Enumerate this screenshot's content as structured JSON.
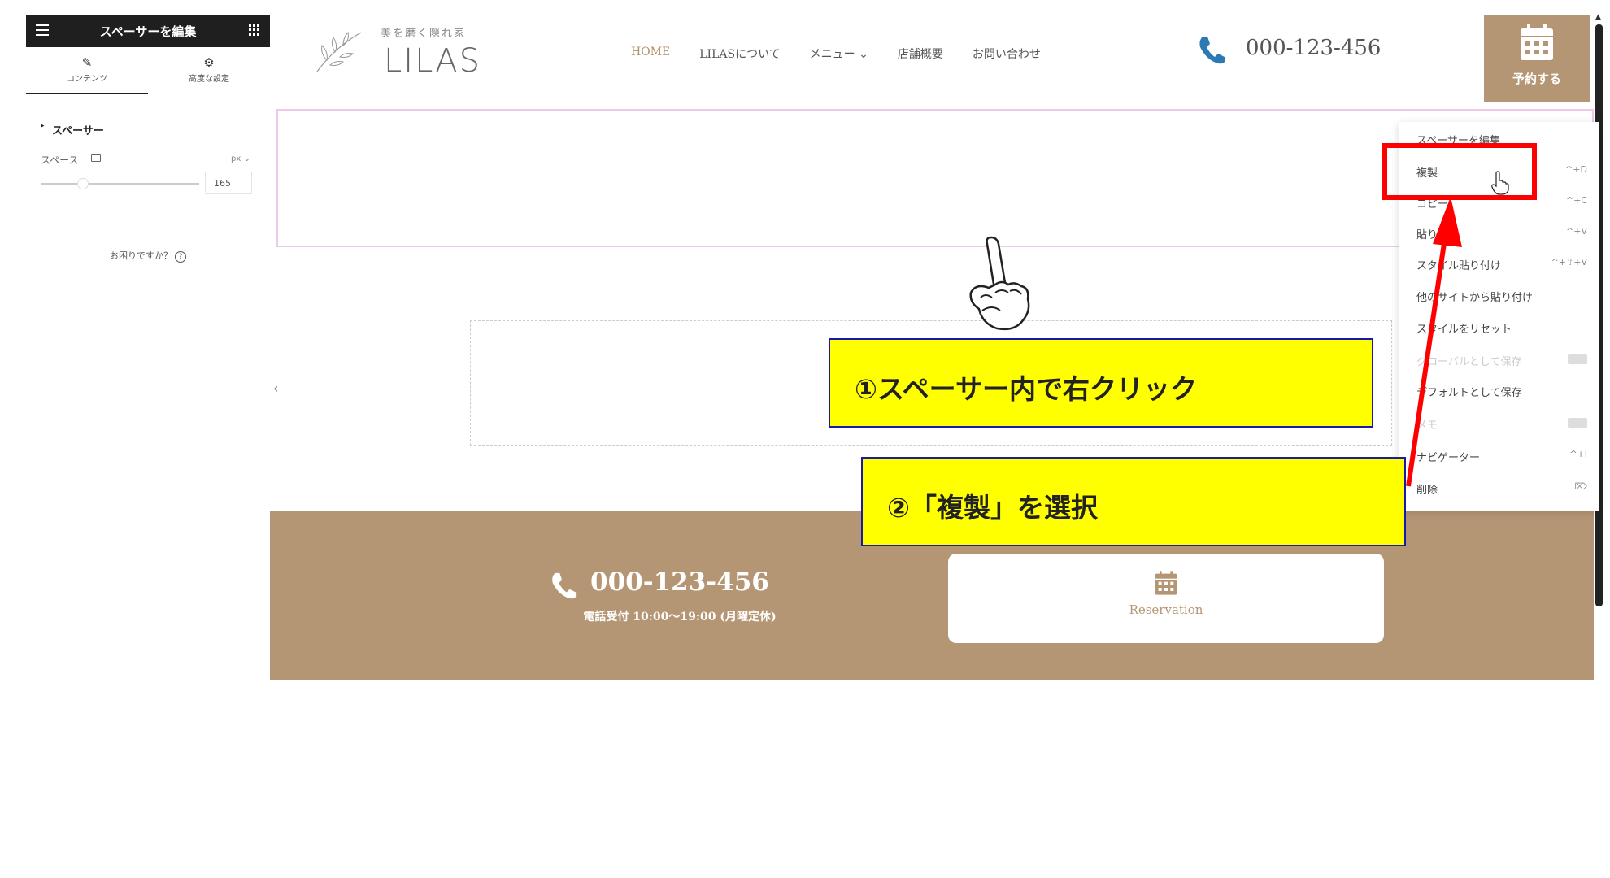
{
  "panel": {
    "title": "スペーサーを編集",
    "tabs": [
      {
        "label": "コンテンツ",
        "icon": "pencil-icon"
      },
      {
        "label": "高度な設定",
        "icon": "gear-icon"
      }
    ],
    "section_title": "スペーサー",
    "space_label": "スペース",
    "unit": "px ⌄",
    "space_value": "165",
    "help_text": "お困りですか？"
  },
  "site": {
    "logo_tagline": "美を磨く隠れ家",
    "logo_name": "LILAS",
    "nav": [
      "HOME",
      "LILASについて",
      "メニュー ⌄",
      "店舗概要",
      "お問い合わせ"
    ],
    "phone": "000-123-456",
    "reserve_label": "予約する"
  },
  "footer": {
    "phone": "000-123-456",
    "hours": "電話受付 10:00〜19:00 (月曜定休)",
    "reservation_label": "Reservation"
  },
  "context_menu": {
    "items": [
      {
        "label": "スペーサーを編集",
        "shortcut": ""
      },
      {
        "label": "複製",
        "shortcut": "^+D"
      },
      {
        "label": "コピー",
        "shortcut": "^+C"
      },
      {
        "label": "貼り付け",
        "shortcut": "^+V"
      },
      {
        "label": "スタイル貼り付け",
        "shortcut": "^+⇧+V"
      },
      {
        "label": "他のサイトから貼り付け",
        "shortcut": ""
      },
      {
        "label": "スタイルをリセット",
        "shortcut": ""
      },
      {
        "label": "グローバルとして保存",
        "shortcut": "PRO",
        "disabled": true
      },
      {
        "label": "デフォルトとして保存",
        "shortcut": ""
      },
      {
        "label": "メモ",
        "shortcut": "PRO",
        "disabled": true
      },
      {
        "label": "ナビゲーター",
        "shortcut": "^+I"
      },
      {
        "label": "削除",
        "shortcut": "⌦"
      }
    ]
  },
  "annotations": {
    "step1": "①スペーサー内で右クリック",
    "step2": "②「複製」を選択"
  },
  "colors": {
    "brand": "#b59674",
    "highlight": "#ffff00",
    "arrow": "#ff0000",
    "spacer_border": "#f0c8ea"
  }
}
